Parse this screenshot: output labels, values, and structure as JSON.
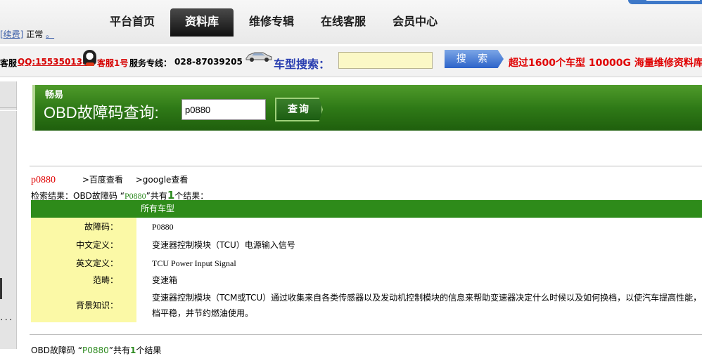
{
  "nav": {
    "items": [
      "平台首页",
      "资料库",
      "维修专辑",
      "在线客服",
      "会员中心"
    ],
    "active": "资料库"
  },
  "account": {
    "renew_link": "[续费]",
    "status": "正常",
    "dot": "。"
  },
  "service": {
    "prefix": "客服",
    "qq": "QQ:1553501388",
    "agent": "客服1号",
    "hotline_label": "服务专线：",
    "hotline": "028-87039205",
    "car_search_label": "车型搜索：",
    "car_search_value": "",
    "search_button": "搜 索",
    "promo": "超过1600个车型  10000G 海量维修资料库"
  },
  "obd": {
    "brand": "畅易",
    "title": "OBD故障码查询:",
    "input_value": "p0880",
    "query_button": "查询"
  },
  "result": {
    "code": "p0880",
    "baidu_link": ">百度查看",
    "google_link": ">google查看",
    "summary_prefix": "检索结果：OBD故障码 “",
    "keyword": "P0880",
    "summary_mid": "”共有",
    "count": "1",
    "summary_suffix": "个结果：",
    "table_header": "所有车型",
    "rows": [
      {
        "label": "故障码：",
        "value": "P0880"
      },
      {
        "label": "中文定义：",
        "value": "变速器控制模块（TCU）电源输入信号"
      },
      {
        "label": "英文定义：",
        "value": "TCU Power Input Signal"
      },
      {
        "label": "范畴：",
        "value": "变速箱"
      },
      {
        "label": "背景知识：",
        "value": "变速器控制模块（TCM或TCU）通过收集来自各类传感器以及发动机控制模块的信息来帮助变速器决定什么时候以及如何换档，以使汽车提高性能，档平稳，并节约燃油使用。"
      }
    ]
  },
  "bottom": {
    "prefix": "OBD故障码 “",
    "keyword": "P0880",
    "mid": "”共有",
    "count": "1",
    "suffix": "个结果"
  },
  "colors": {
    "header_green": "#2e8b1a",
    "label_yellow": "#fbf9a6",
    "code_red": "#e00000",
    "link_blue": "#2a3fb0"
  }
}
